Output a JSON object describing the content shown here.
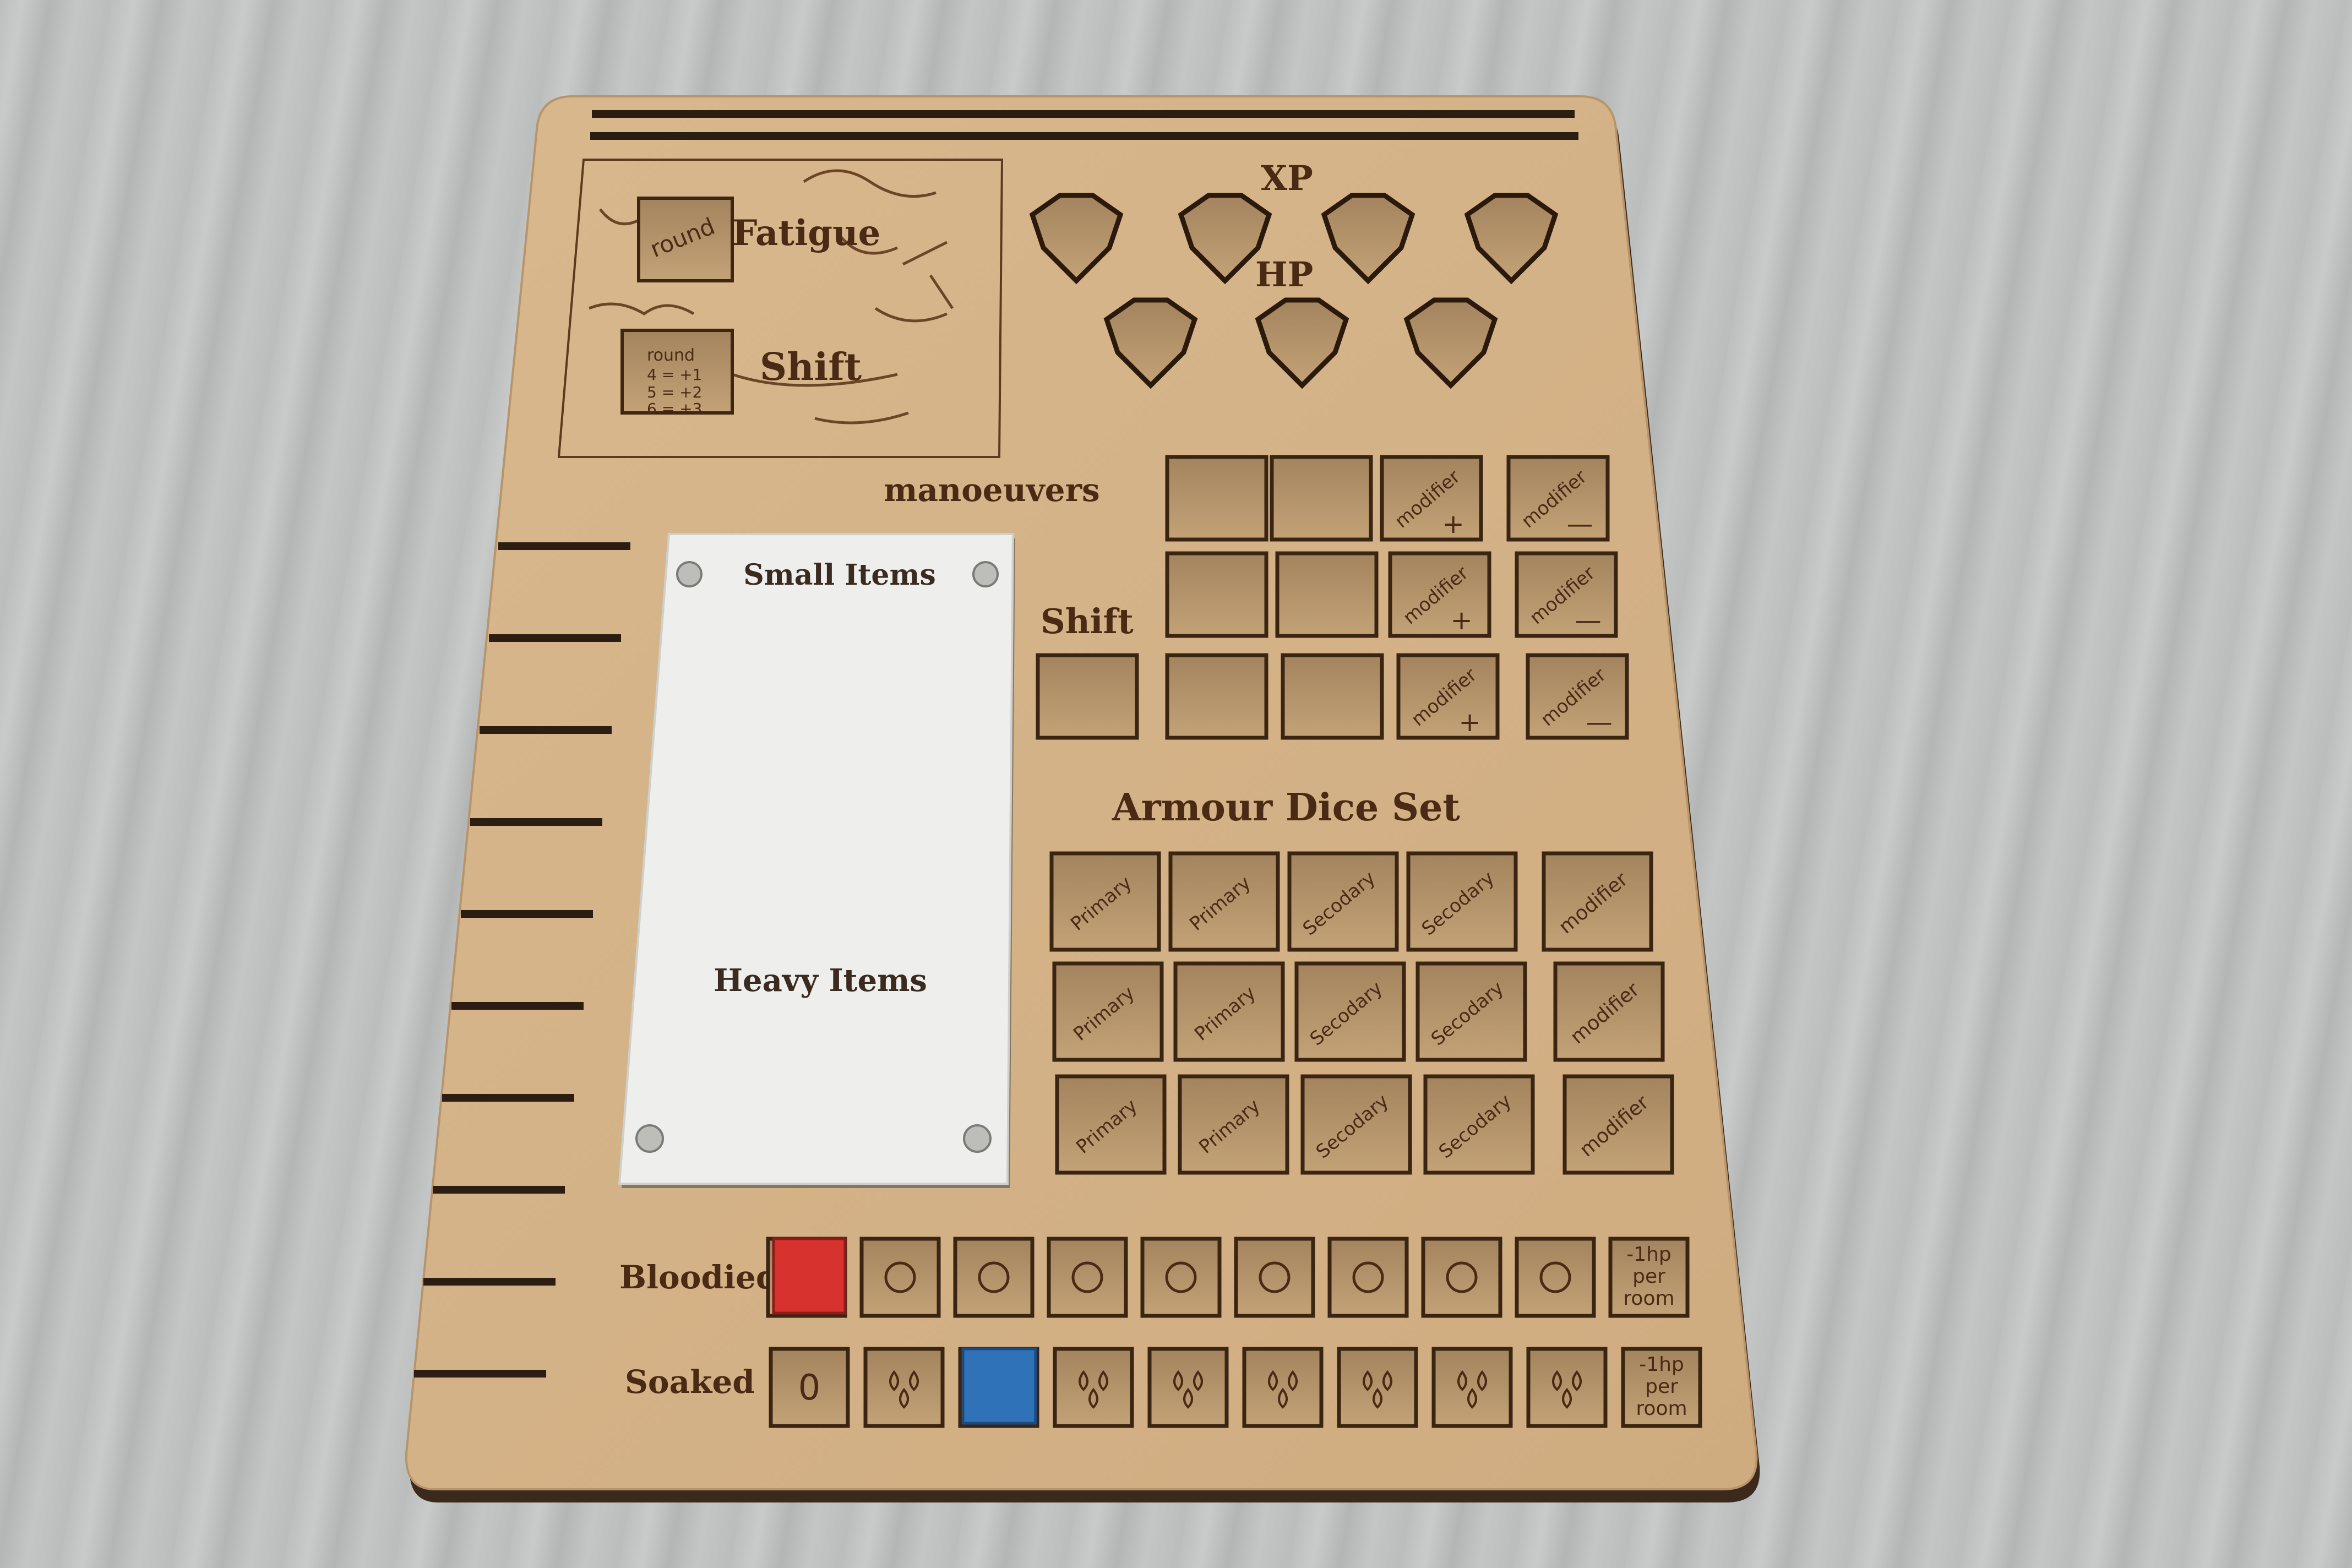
{
  "board": {
    "fatigue_label": "Fatigue",
    "shift_label": "Shift",
    "round_label_1": "round",
    "round_label_2": "round",
    "round_rules": [
      "4 = +1",
      "5 = +2",
      "6 = +3"
    ],
    "xp_label": "XP",
    "hp_label": "HP",
    "manoeuvers_label": "manoeuvers",
    "shift_row_label": "Shift",
    "modifier_text": "modifier",
    "armour_label": "Armour Dice Set",
    "primary_text": "Primary",
    "secondary_text": "Secodary",
    "bloodied_label": "Bloodied",
    "soaked_label": "Soaked",
    "zero_text": "0",
    "penalty_lines": [
      "-1hp",
      "per",
      "room"
    ]
  },
  "card": {
    "top_label": "Small Items",
    "bottom_label": "Heavy Items"
  },
  "colors": {
    "table": "#c2c4c3",
    "board": "#d6b48a",
    "engrave": "#4a2a14",
    "card": "#eeeeec",
    "red_token": "#d8322e",
    "blue_token": "#2f72b8"
  }
}
